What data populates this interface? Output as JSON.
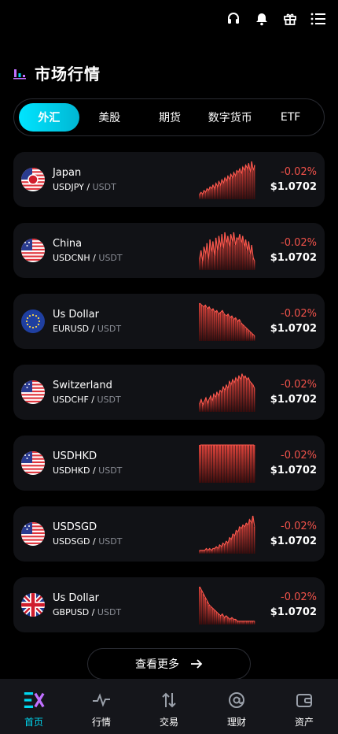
{
  "header": {
    "icons": [
      "headset-icon",
      "bell-icon",
      "gift-icon",
      "menu-icon"
    ],
    "title": "市场行情"
  },
  "tabs": [
    {
      "label": "外汇",
      "active": true
    },
    {
      "label": "美股",
      "active": false
    },
    {
      "label": "期货",
      "active": false
    },
    {
      "label": "数字货币",
      "active": false
    },
    {
      "label": "ETF",
      "active": false
    }
  ],
  "markets": [
    {
      "name": "Japan",
      "base": "USDJPY",
      "quote": "USDT",
      "change": "-0.02%",
      "price": "$1.0702",
      "flag": "jp",
      "spark": [
        2,
        3,
        2,
        4,
        3,
        5,
        4,
        6,
        5,
        7,
        5,
        8,
        6,
        9,
        7,
        10,
        8,
        11,
        9,
        12,
        10,
        13,
        11,
        14,
        12,
        15,
        14,
        16,
        13,
        17,
        15,
        18,
        16,
        19,
        14,
        20,
        15,
        18
      ]
    },
    {
      "name": "China",
      "base": "USDCNH",
      "quote": "USDT",
      "change": "-0.02%",
      "price": "$1.0702",
      "flag": "us",
      "spark": [
        6,
        10,
        4,
        12,
        8,
        14,
        5,
        16,
        9,
        15,
        7,
        17,
        10,
        18,
        12,
        19,
        11,
        20,
        14,
        18,
        12,
        19,
        15,
        20,
        13,
        17,
        16,
        19,
        14,
        18,
        12,
        16,
        10,
        15,
        8,
        13,
        6,
        4
      ]
    },
    {
      "name": "Us Dollar",
      "base": "EURUSD",
      "quote": "USDT",
      "change": "-0.02%",
      "price": "$1.0702",
      "flag": "eu",
      "spark": [
        20,
        19,
        18,
        19,
        17,
        18,
        16,
        17,
        15,
        16,
        14,
        15,
        16,
        14,
        13,
        14,
        12,
        13,
        11,
        12,
        10,
        11,
        9,
        8,
        7,
        6,
        5,
        4,
        3,
        2
      ]
    },
    {
      "name": "Switzerland",
      "base": "USDCHF",
      "quote": "USDT",
      "change": "-0.02%",
      "price": "$1.0702",
      "flag": "us",
      "spark": [
        4,
        6,
        3,
        5,
        7,
        4,
        6,
        8,
        5,
        9,
        7,
        10,
        8,
        11,
        10,
        13,
        11,
        14,
        12,
        16,
        14,
        17,
        15,
        18,
        16,
        19,
        17,
        20,
        18,
        19,
        17,
        18,
        16,
        15,
        14,
        12
      ]
    },
    {
      "name": "USDHKD",
      "base": "USDHKD",
      "quote": "USDT",
      "change": "-0.02%",
      "price": "$1.0702",
      "flag": "us",
      "spark": [
        20,
        20,
        20,
        20,
        20,
        20,
        20,
        20,
        20,
        20,
        20,
        20,
        20,
        20,
        20,
        20,
        20,
        20,
        20,
        20
      ]
    },
    {
      "name": "USDSGD",
      "base": "USDSGD",
      "quote": "USDT",
      "change": "-0.02%",
      "price": "$1.0702",
      "flag": "us",
      "spark": [
        1,
        1,
        1,
        1,
        2,
        1,
        2,
        1,
        2,
        2,
        3,
        2,
        4,
        3,
        5,
        4,
        6,
        5,
        8,
        7,
        10,
        9,
        12,
        11,
        14,
        13,
        15,
        14,
        16,
        15,
        18,
        16,
        20,
        14
      ]
    },
    {
      "name": "Us Dollar",
      "base": "GBPUSD",
      "quote": "USDT",
      "change": "-0.02%",
      "price": "$1.0702",
      "flag": "gb",
      "spark": [
        20,
        18,
        16,
        14,
        12,
        10,
        9,
        8,
        7,
        6,
        5,
        4,
        5,
        3,
        4,
        3,
        2,
        3,
        2,
        2,
        1,
        1,
        1,
        1,
        1,
        1,
        1,
        1,
        1,
        1
      ]
    }
  ],
  "more_button": {
    "label": "查看更多"
  },
  "nav": [
    {
      "label": "首页",
      "icon": "exchange-logo-icon",
      "active": true
    },
    {
      "label": "行情",
      "icon": "pulse-icon",
      "active": false
    },
    {
      "label": "交易",
      "icon": "swap-arrows-icon",
      "active": false
    },
    {
      "label": "理财",
      "icon": "at-circle-icon",
      "active": false
    },
    {
      "label": "资产",
      "icon": "wallet-icon",
      "active": false
    }
  ],
  "colors": {
    "accent": "#00d8f0",
    "down": "#f0524a",
    "card": "#111216"
  }
}
